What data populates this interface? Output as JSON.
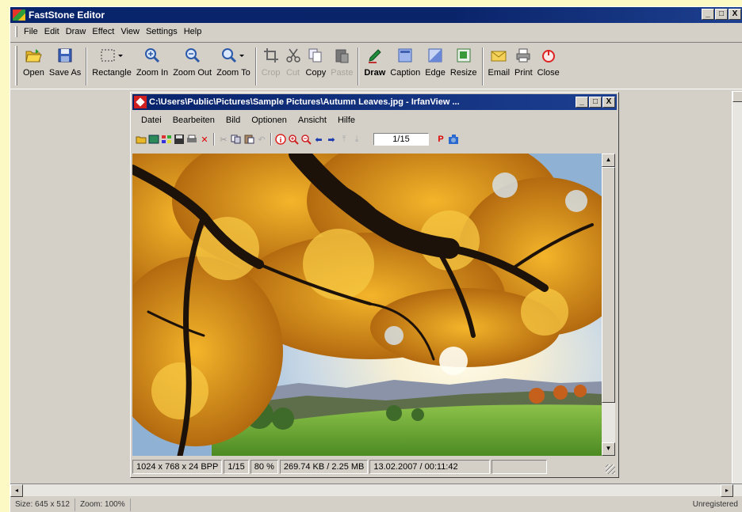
{
  "app": {
    "title": "FastStone Editor",
    "window_buttons": [
      "_",
      "□",
      "X"
    ]
  },
  "menu": [
    {
      "label": "File"
    },
    {
      "label": "Edit"
    },
    {
      "label": "Draw"
    },
    {
      "label": "Effect"
    },
    {
      "label": "View"
    },
    {
      "label": "Settings"
    },
    {
      "label": "Help"
    }
  ],
  "toolbar": [
    {
      "label": "Open",
      "icon": "folder-open-icon",
      "enabled": true,
      "bold": false
    },
    {
      "label": "Save As",
      "icon": "floppy-disk-icon",
      "enabled": true,
      "bold": false
    },
    {
      "label": "Rectangle",
      "icon": "rectangle-select-icon",
      "enabled": true,
      "bold": false
    },
    {
      "label": "Zoom In",
      "icon": "zoom-in-icon",
      "enabled": true,
      "bold": false
    },
    {
      "label": "Zoom Out",
      "icon": "zoom-out-icon",
      "enabled": true,
      "bold": false
    },
    {
      "label": "Zoom To",
      "icon": "zoom-to-icon",
      "enabled": true,
      "bold": false
    },
    {
      "label": "Crop",
      "icon": "crop-icon",
      "enabled": false,
      "bold": false
    },
    {
      "label": "Cut",
      "icon": "scissors-icon",
      "enabled": false,
      "bold": false
    },
    {
      "label": "Copy",
      "icon": "copy-icon",
      "enabled": true,
      "bold": false
    },
    {
      "label": "Paste",
      "icon": "paste-icon",
      "enabled": false,
      "bold": false
    },
    {
      "label": "Draw",
      "icon": "draw-pen-icon",
      "enabled": true,
      "bold": true
    },
    {
      "label": "Caption",
      "icon": "caption-icon",
      "enabled": true,
      "bold": false
    },
    {
      "label": "Edge",
      "icon": "edge-icon",
      "enabled": true,
      "bold": false
    },
    {
      "label": "Resize",
      "icon": "resize-icon",
      "enabled": true,
      "bold": false
    },
    {
      "label": "Email",
      "icon": "email-envelope-icon",
      "enabled": true,
      "bold": false
    },
    {
      "label": "Print",
      "icon": "printer-icon",
      "enabled": true,
      "bold": false
    },
    {
      "label": "Close",
      "icon": "power-close-icon",
      "enabled": true,
      "bold": false
    }
  ],
  "status": {
    "size": "Size: 645 x 512",
    "zoom": "Zoom: 100%",
    "registration": "Unregistered"
  },
  "irfanview": {
    "title": "C:\\Users\\Public\\Pictures\\Sample Pictures\\Autumn Leaves.jpg - IrfanView ...",
    "menu": [
      {
        "label": "Datei"
      },
      {
        "label": "Bearbeiten"
      },
      {
        "label": "Bild"
      },
      {
        "label": "Optionen"
      },
      {
        "label": "Ansicht"
      },
      {
        "label": "Hilfe"
      }
    ],
    "page_indicator": "1/15",
    "status": {
      "dimensions": "1024 x 768 x 24 BPP",
      "page": "1/15",
      "zoom": "80 %",
      "filesize": "269.74 KB / 2.25 MB",
      "datetime": "13.02.2007 / 00:11:42"
    }
  },
  "colors": {
    "titlebar": "#0a246a",
    "chrome": "#d4d0c8",
    "backdrop": "#fdf9c4"
  }
}
